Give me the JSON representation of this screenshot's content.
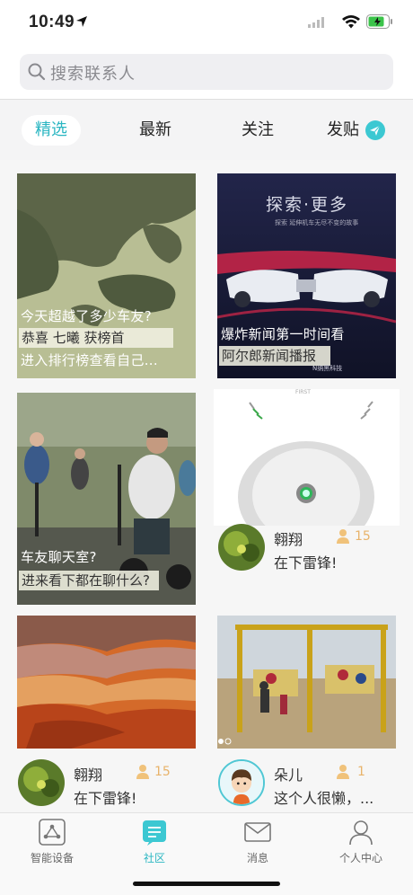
{
  "status": {
    "time": "10:49"
  },
  "search": {
    "placeholder": "搜索联系人"
  },
  "tabs": [
    {
      "label": "精选",
      "active": true
    },
    {
      "label": "最新",
      "active": false
    },
    {
      "label": "关注",
      "active": false
    },
    {
      "label": "发贴",
      "active": false
    }
  ],
  "cards": {
    "leaderboard": {
      "line1": "今天超越了多少车友?",
      "line2": "恭喜 七曦 获榜首",
      "line3": "进入排行榜查看自己..."
    },
    "news": {
      "banner_title": "探索·更多",
      "banner_sub": "探索  延伸机车无尽不变的故事",
      "line1": "爆炸新闻第一时间看",
      "line2": "阿尔郎新闻播报",
      "brand": "N纳黑科技"
    },
    "chat": {
      "line1": "车友聊天室?",
      "line2": "进来看下都在聊什么?"
    },
    "product": {
      "top_text": "FIRST"
    },
    "post1": {
      "author": "翱翔",
      "likes": "15",
      "sign": "在下雷锋!"
    },
    "post2": {
      "author": "翱翔",
      "likes": "15",
      "sign": "在下雷锋!"
    },
    "post3": {
      "author": "朵儿",
      "likes": "1",
      "sign": "这个人很懒，..."
    }
  },
  "tabbar": [
    {
      "label": "智能设备",
      "icon": "device-icon",
      "active": false
    },
    {
      "label": "社区",
      "icon": "community-icon",
      "active": true
    },
    {
      "label": "消息",
      "icon": "mail-icon",
      "active": false
    },
    {
      "label": "个人中心",
      "icon": "person-icon",
      "active": false
    }
  ],
  "colors": {
    "accent": "#2ab6c2",
    "like": "#e8b36a",
    "tabs_bg": "#f4f4f5"
  }
}
